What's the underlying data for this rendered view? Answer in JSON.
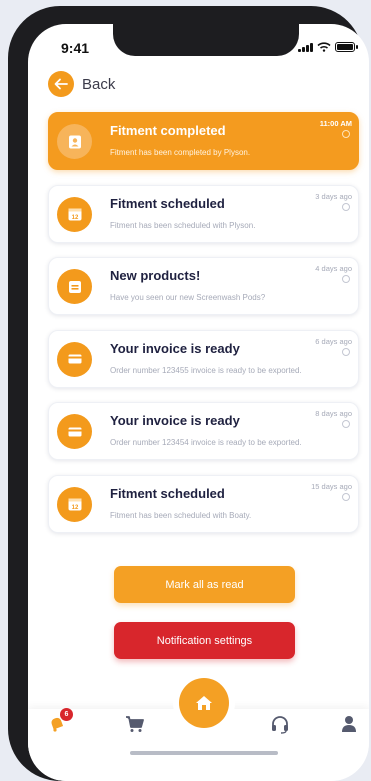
{
  "status_bar": {
    "time": "9:41"
  },
  "header": {
    "back_label": "Back"
  },
  "notifications": [
    {
      "title": "Fitment completed",
      "description": "Fitment has been completed by Plyson.",
      "time": "11:00 AM",
      "icon": "contact-card-icon",
      "active": true
    },
    {
      "title": "Fitment scheduled",
      "description": "Fitment has been scheduled with Plyson.",
      "time": "3 days ago",
      "icon": "calendar-icon",
      "calendar_day": "12",
      "active": false
    },
    {
      "title": "New products!",
      "description": "Have you seen our new Screenwash Pods?",
      "time": "4 days ago",
      "icon": "box-icon",
      "active": false
    },
    {
      "title": "Your invoice is ready",
      "description": "Order number 123455 invoice is ready to be exported.",
      "time": "6 days ago",
      "icon": "credit-card-icon",
      "active": false
    },
    {
      "title": "Your invoice is ready",
      "description": "Order number 123454 invoice is ready to be exported.",
      "time": "8 days ago",
      "icon": "credit-card-icon",
      "active": false
    },
    {
      "title": "Fitment scheduled",
      "description": "Fitment has been scheduled with Boaty.",
      "time": "15 days ago",
      "icon": "calendar-icon",
      "calendar_day": "12",
      "active": false
    }
  ],
  "actions": {
    "mark_all_read": "Mark all as read",
    "notification_settings": "Notification settings"
  },
  "tabbar": {
    "notifications_badge": "6",
    "tabs": [
      "bell-icon",
      "cart-icon",
      "home-icon",
      "headset-icon",
      "user-icon"
    ]
  },
  "colors": {
    "accent": "#f49b1f",
    "danger": "#d8262c",
    "title_text": "#1f2140",
    "muted_text": "#a6aab8"
  }
}
